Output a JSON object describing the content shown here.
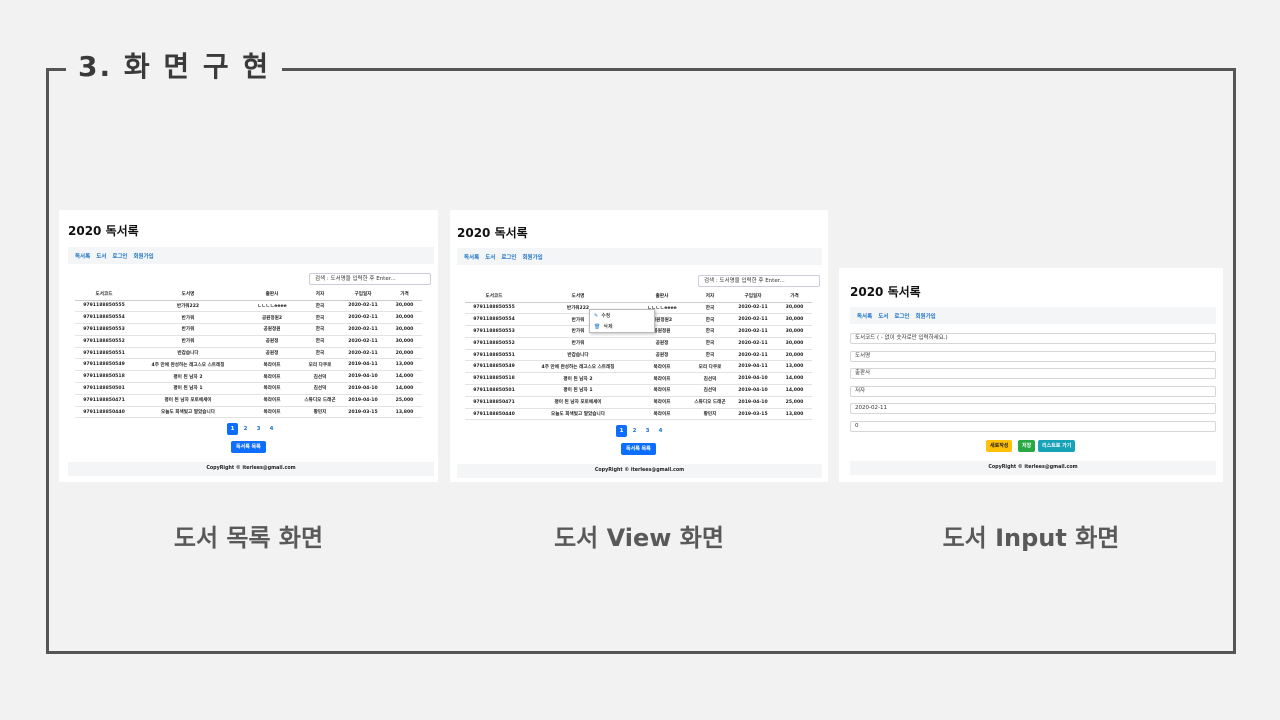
{
  "slide": {
    "section_title": "3. 화 면 구 현",
    "captions": [
      "도서 목록 화면",
      "도서 View 화면",
      "도서 Input 화면"
    ]
  },
  "app": {
    "title": "2020 독서록",
    "nav": [
      "독서록",
      "도서",
      "로그인",
      "회원가입"
    ],
    "search_placeholder": "검색 : 도서명을 입력한 후 Enter...",
    "columns": [
      "도서코드",
      "도서명",
      "출판사",
      "저자",
      "구입일자",
      "가격"
    ],
    "rows": [
      [
        "9791188850555",
        "반가워222",
        "ㄴㄴㄴㄴeeee",
        "한국",
        "2020-02-11",
        "30,000"
      ],
      [
        "9791188850554",
        "반가워",
        "공원정원2",
        "한국",
        "2020-02-11",
        "30,000"
      ],
      [
        "9791188850553",
        "반가워",
        "공원정원",
        "한국",
        "2020-02-11",
        "30,000"
      ],
      [
        "9791188850552",
        "반가워",
        "공원정",
        "한국",
        "2020-02-11",
        "30,000"
      ],
      [
        "9791188850551",
        "반갑습니다",
        "공원정",
        "한국",
        "2020-02-11",
        "20,000"
      ],
      [
        "9791188850549",
        "4주 만에 완성하는 레고스오 스트레칭",
        "북라이프",
        "모리 다쿠로",
        "2019-04-11",
        "13,000"
      ],
      [
        "9791188850518",
        "평이 된 남자 2",
        "북라이프",
        "김선덕",
        "2019-04-10",
        "14,000"
      ],
      [
        "9791188850501",
        "평이 된 남자 1",
        "북라이프",
        "김선덕",
        "2019-04-10",
        "14,000"
      ],
      [
        "9791188850471",
        "평이 된 남자 포토에세이",
        "북라이프",
        "스튜디오 드래곤",
        "2019-04-10",
        "25,000"
      ],
      [
        "9791188850440",
        "오늘도 회색빛고 말았습니다",
        "북라이프",
        "황민지",
        "2019-03-15",
        "13,800"
      ]
    ],
    "pages": [
      "1",
      "2",
      "3",
      "4"
    ],
    "list_button": "독서록 목록",
    "footer": "CopyRight © iterlees@gmail.com"
  },
  "context_menu": {
    "edit": "수정",
    "delete": "삭제"
  },
  "input_form": {
    "fields": [
      "도서코드 ( - 없이 숫자로만 입력하세요.)",
      "도서명",
      "출판사",
      "저자",
      "2020-02-11",
      "0"
    ],
    "buttons": {
      "new": "새로작성",
      "save": "저장",
      "list": "리스트로 가기"
    }
  },
  "colors": {
    "primary": "#0d6efd",
    "warning": "#ffc107",
    "success": "#28a745",
    "info": "#17a2b8",
    "link": "#1a73c9"
  }
}
